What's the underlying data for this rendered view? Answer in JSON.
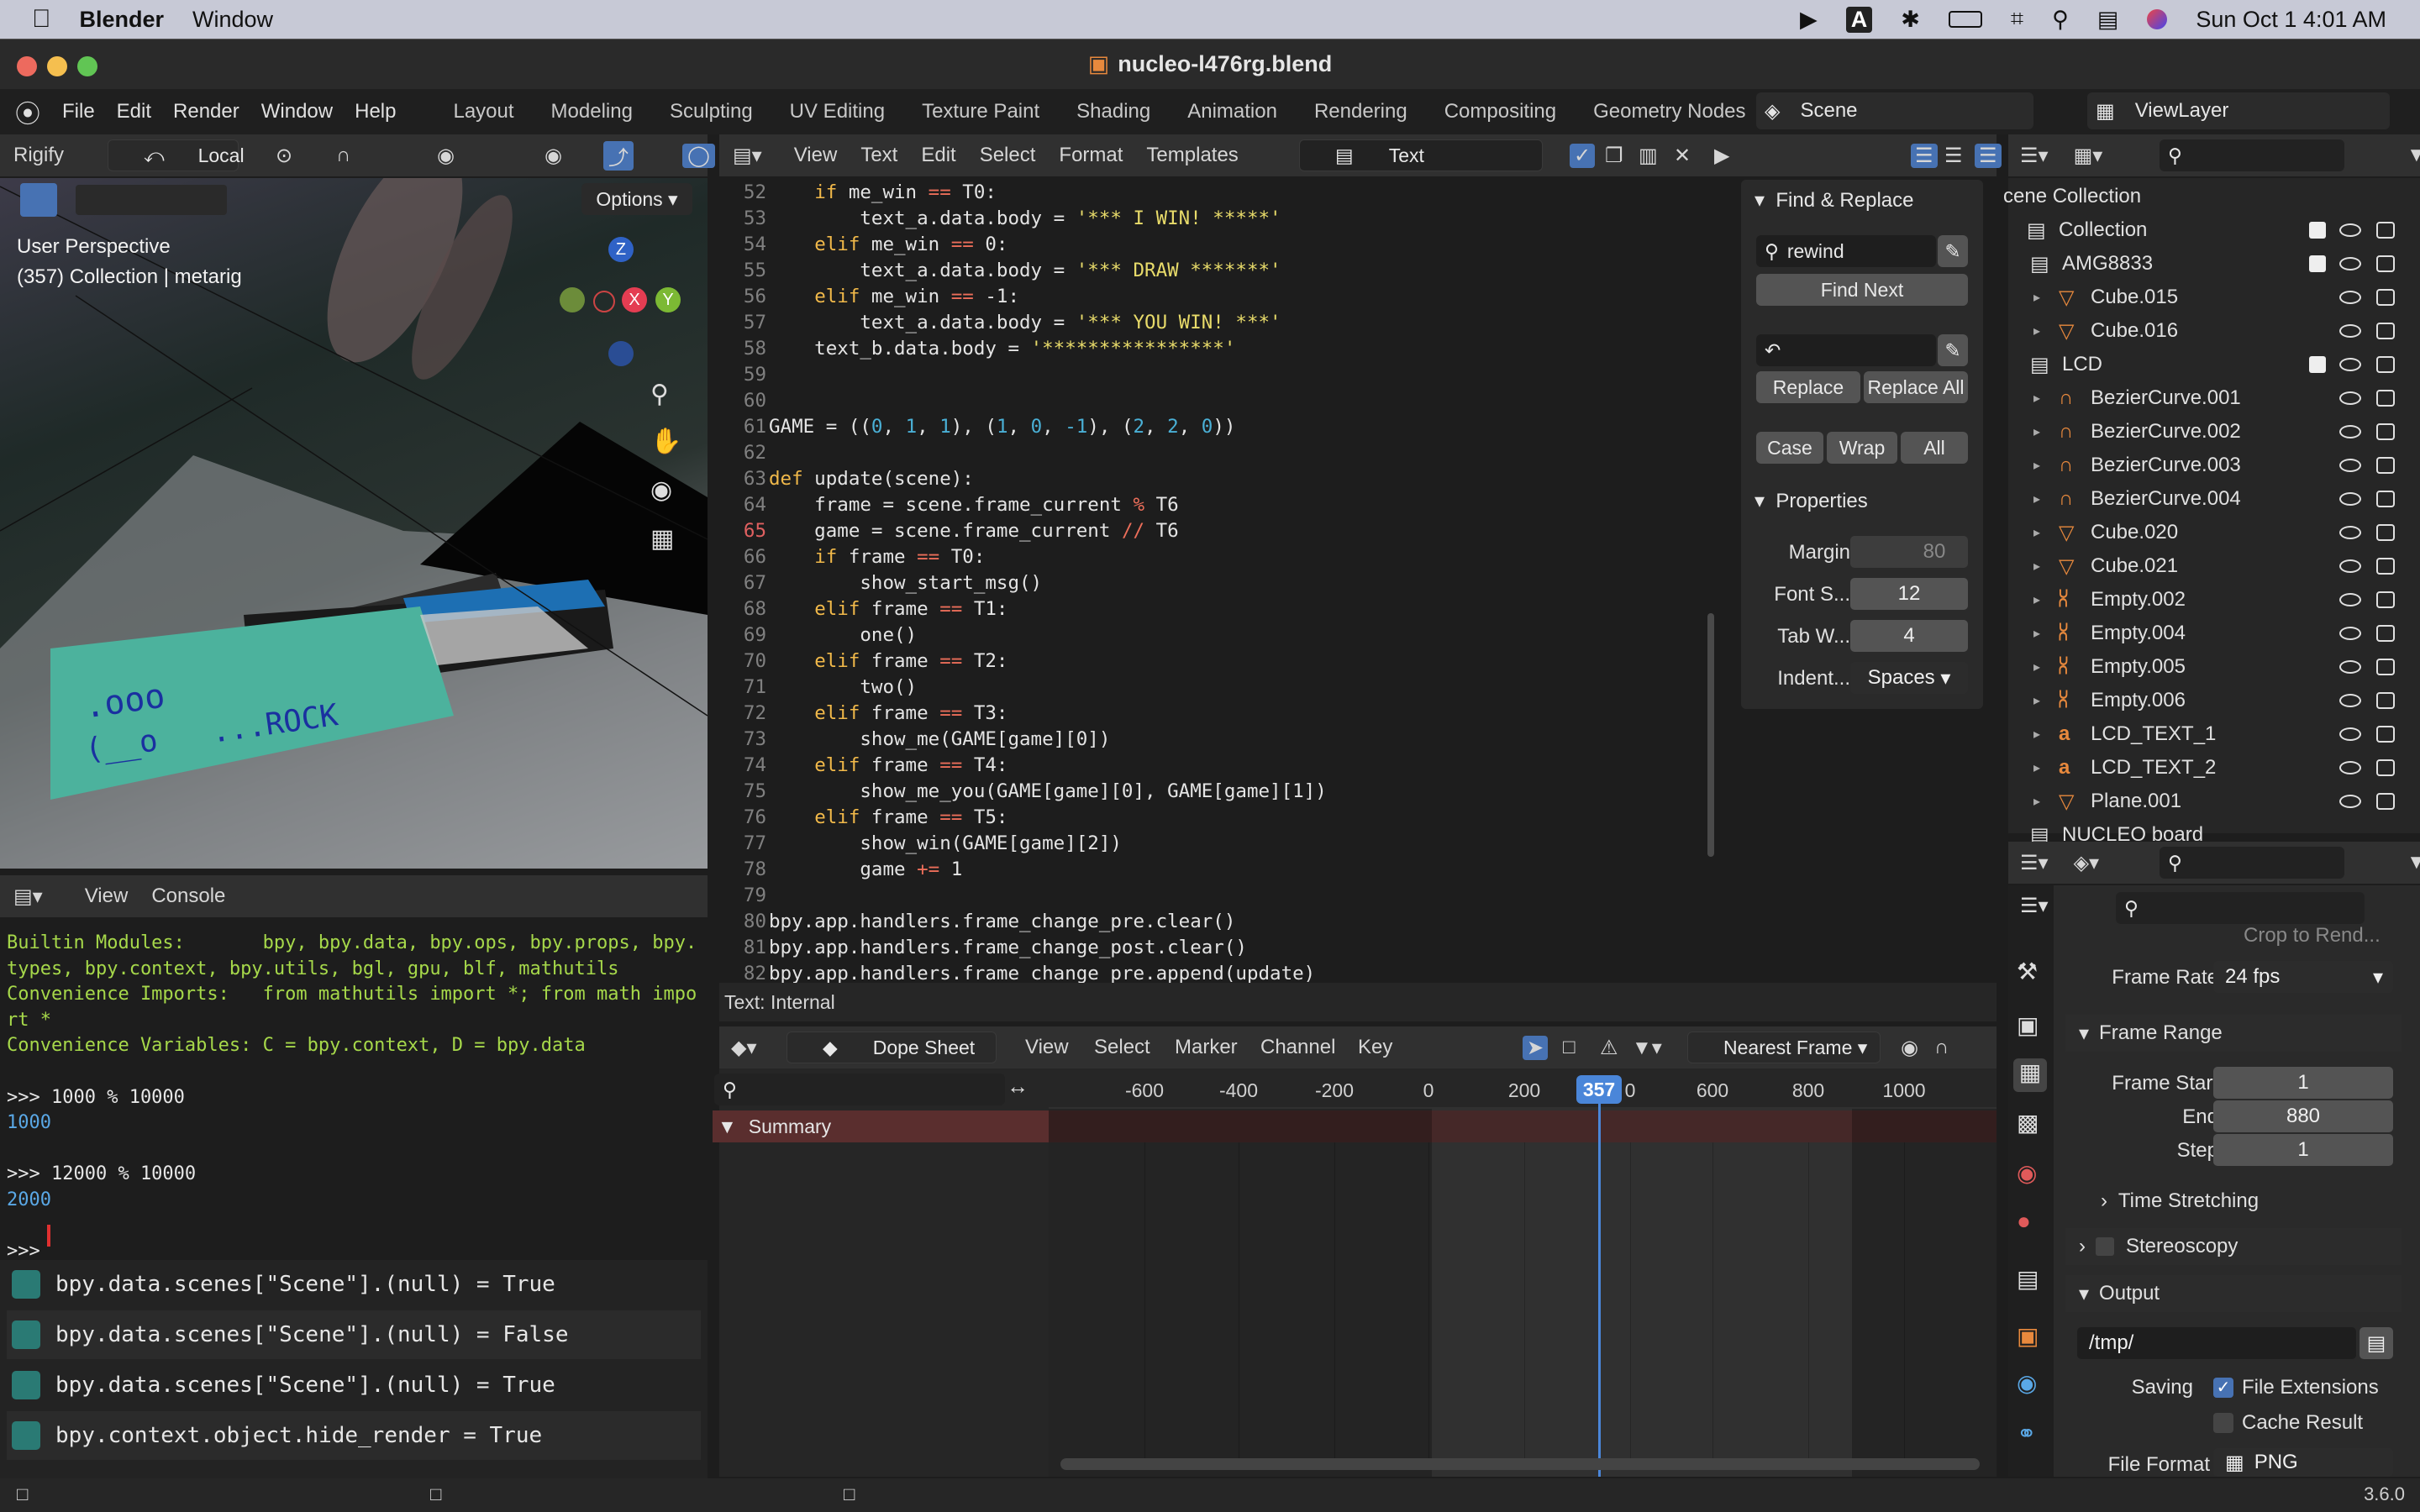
{
  "mac": {
    "app": "Blender",
    "menu1": "Window",
    "clock": "Sun Oct 1  4:01 AM"
  },
  "window": {
    "title": "nucleo-l476rg.blend"
  },
  "menu": {
    "items": [
      "File",
      "Edit",
      "Render",
      "Window",
      "Help"
    ],
    "workspaces": [
      "Layout",
      "Modeling",
      "Sculpting",
      "UV Editing",
      "Texture Paint",
      "Shading",
      "Animation",
      "Rendering",
      "Compositing",
      "Geometry Nodes"
    ],
    "scene": "Scene",
    "viewlayer": "ViewLayer"
  },
  "viewport": {
    "rig": "Rigify",
    "orient": "Local",
    "options": "Options",
    "perspective": "User Perspective",
    "collection": "(357) Collection | metarig",
    "axes": {
      "z": "Z",
      "x": "X",
      "y": "Y"
    },
    "card_text1": ".ooo",
    "card_text2": "(__o   ...ROCK"
  },
  "texted": {
    "menu": [
      "View",
      "Text",
      "Edit",
      "Select",
      "Format",
      "Templates"
    ],
    "textname": "Text",
    "status": "Text: Internal",
    "lines": [
      {
        "n": "52",
        "t": "    if me_win == T0:"
      },
      {
        "n": "53",
        "t": "        text_a.data.body = '*** I WIN! *****'"
      },
      {
        "n": "54",
        "t": "    elif me_win == 0:"
      },
      {
        "n": "55",
        "t": "        text_a.data.body = '*** DRAW *******'"
      },
      {
        "n": "56",
        "t": "    elif me_win == -1:"
      },
      {
        "n": "57",
        "t": "        text_a.data.body = '*** YOU WIN! ***'"
      },
      {
        "n": "58",
        "t": "    text_b.data.body = '****************'"
      },
      {
        "n": "59",
        "t": ""
      },
      {
        "n": "60",
        "t": ""
      },
      {
        "n": "61",
        "t": "GAME = ((0, 1, 1), (1, 0, -1), (2, 2, 0))"
      },
      {
        "n": "62",
        "t": ""
      },
      {
        "n": "63",
        "t": "def update(scene):"
      },
      {
        "n": "64",
        "t": "    frame = scene.frame_current % T6"
      },
      {
        "n": "65",
        "t": "    game = scene.frame_current // T6"
      },
      {
        "n": "66",
        "t": "    if frame == T0:"
      },
      {
        "n": "67",
        "t": "        show_start_msg()"
      },
      {
        "n": "68",
        "t": "    elif frame == T1:"
      },
      {
        "n": "69",
        "t": "        one()"
      },
      {
        "n": "70",
        "t": "    elif frame == T2:"
      },
      {
        "n": "71",
        "t": "        two()"
      },
      {
        "n": "72",
        "t": "    elif frame == T3:"
      },
      {
        "n": "73",
        "t": "        show_me(GAME[game][0])"
      },
      {
        "n": "74",
        "t": "    elif frame == T4:"
      },
      {
        "n": "75",
        "t": "        show_me_you(GAME[game][0], GAME[game][1])"
      },
      {
        "n": "76",
        "t": "    elif frame == T5:"
      },
      {
        "n": "77",
        "t": "        show_win(GAME[game][2])"
      },
      {
        "n": "78",
        "t": "        game += 1"
      },
      {
        "n": "79",
        "t": ""
      },
      {
        "n": "80",
        "t": "bpy.app.handlers.frame_change_pre.clear()"
      },
      {
        "n": "81",
        "t": "bpy.app.handlers.frame_change_post.clear()"
      },
      {
        "n": "82",
        "t": "bpy.app.handlers.frame_change_pre.append(update)"
      }
    ]
  },
  "findreplace": {
    "title": "Find & Replace",
    "find": "rewind",
    "find_next": "Find Next",
    "replace": "Replace",
    "replace_all": "Replace All",
    "case": "Case",
    "wrap": "Wrap",
    "all": "All",
    "props_title": "Properties",
    "margin_l": "Margin",
    "margin_v": "80",
    "font_l": "Font S...",
    "font_v": "12",
    "tab_l": "Tab W...",
    "tab_v": "4",
    "indent_l": "Indent...",
    "indent_v": "Spaces"
  },
  "console": {
    "menu": [
      "View",
      "Console"
    ],
    "lines": [
      {
        "t": "Builtin Modules:       bpy, bpy.data, bpy.ops, bpy.props, bpy.",
        "c": "#a6d84a"
      },
      {
        "t": "types, bpy.context, bpy.utils, bgl, gpu, blf, mathutils",
        "c": "#a6d84a"
      },
      {
        "t": "Convenience Imports:   from mathutils import *; from math impo",
        "c": "#a6d84a"
      },
      {
        "t": "rt *",
        "c": "#a6d84a"
      },
      {
        "t": "Convenience Variables: C = bpy.context, D = bpy.data",
        "c": "#a6d84a"
      },
      {
        "t": "",
        "c": "#fff"
      },
      {
        "t": ">>> 1000 % 10000",
        "c": "#e6e6e6"
      },
      {
        "t": "1000",
        "c": "#5aa8e6"
      },
      {
        "t": "",
        "c": "#fff"
      },
      {
        "t": ">>> 12000 % 10000",
        "c": "#e6e6e6"
      },
      {
        "t": "2000",
        "c": "#5aa8e6"
      },
      {
        "t": "",
        "c": "#fff"
      },
      {
        "t": ">>> ",
        "c": "#e6e6e6"
      }
    ],
    "info": [
      "bpy.data.scenes[\"Scene\"].(null) = True",
      "bpy.data.scenes[\"Scene\"].(null) = False",
      "bpy.data.scenes[\"Scene\"].(null) = True",
      "bpy.context.object.hide_render = True"
    ]
  },
  "outliner": {
    "root": "cene Collection",
    "rows": [
      {
        "l": "Collection",
        "i": 0,
        "t": "col",
        "c": true
      },
      {
        "l": "AMG8833",
        "i": 1,
        "t": "col",
        "c": true
      },
      {
        "l": "Cube.015",
        "i": 2,
        "t": "mesh"
      },
      {
        "l": "Cube.016",
        "i": 2,
        "t": "mesh"
      },
      {
        "l": "LCD",
        "i": 1,
        "t": "col",
        "c": true
      },
      {
        "l": "BezierCurve.001",
        "i": 2,
        "t": "curve"
      },
      {
        "l": "BezierCurve.002",
        "i": 2,
        "t": "curve"
      },
      {
        "l": "BezierCurve.003",
        "i": 2,
        "t": "curve"
      },
      {
        "l": "BezierCurve.004",
        "i": 2,
        "t": "curve"
      },
      {
        "l": "Cube.020",
        "i": 2,
        "t": "mesh"
      },
      {
        "l": "Cube.021",
        "i": 2,
        "t": "mesh"
      },
      {
        "l": "Empty.002",
        "i": 2,
        "t": "empty"
      },
      {
        "l": "Empty.004",
        "i": 2,
        "t": "empty"
      },
      {
        "l": "Empty.005",
        "i": 2,
        "t": "empty"
      },
      {
        "l": "Empty.006",
        "i": 2,
        "t": "empty"
      },
      {
        "l": "LCD_TEXT_1",
        "i": 2,
        "t": "text"
      },
      {
        "l": "LCD_TEXT_2",
        "i": 2,
        "t": "text"
      },
      {
        "l": "Plane.001",
        "i": 2,
        "t": "mesh"
      },
      {
        "l": "NUCLEO board",
        "i": 1,
        "t": "col"
      }
    ]
  },
  "dopesheet": {
    "mode": "Dope Sheet",
    "menu": [
      "View",
      "Select",
      "Marker",
      "Channel",
      "Key"
    ],
    "snap": "Nearest Frame",
    "summary": "Summary",
    "current_frame": "357",
    "ticks": [
      "-600",
      "-400",
      "-200",
      "0",
      "200",
      "0",
      "600",
      "800",
      "1000"
    ]
  },
  "props": {
    "crop": "Crop to Rend...",
    "frame_rate_l": "Frame Rate",
    "frame_rate_v": "24 fps",
    "frame_range": "Frame Range",
    "start_l": "Frame Start",
    "start_v": "1",
    "end_l": "End",
    "end_v": "880",
    "step_l": "Step",
    "step_v": "1",
    "time_stretching": "Time Stretching",
    "stereoscopy": "Stereoscopy",
    "output": "Output",
    "path": "/tmp/",
    "saving_l": "Saving",
    "file_ext": "File Extensions",
    "cache": "Cache Result",
    "format_l": "File Format",
    "format_v": "PNG"
  },
  "status": {
    "version": "3.6.0"
  }
}
